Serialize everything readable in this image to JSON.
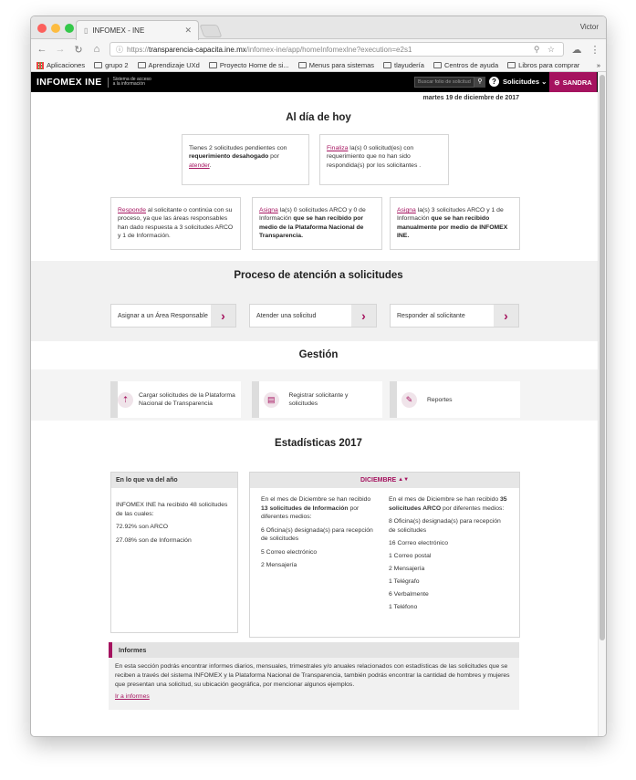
{
  "browser": {
    "tab_title": "INFOMEX - INE",
    "profile_name": "Victor",
    "url_protocol": "https://",
    "url_host": "transparencia-capacita.ine.mx",
    "url_path": "/infomex-ine/app/homeInfomexIne?execution=e2s1",
    "bookmarks": [
      "Aplicaciones",
      "grupo 2",
      "Aprendizaje UXd",
      "Proyecto Home de si...",
      "Menus para sistemas",
      "tlayudería",
      "Centros de ayuda",
      "Libros para comprar"
    ],
    "bookmarks_more": "»"
  },
  "header": {
    "logo": "INFOMEX INE",
    "logo_sub_1": "Sistema de acceso",
    "logo_sub_2": "a la información",
    "search_placeholder": "Buscar folio de solicitud",
    "help_label": "?",
    "solicitudes_label": "Solicitudes",
    "user_label": "SANDRA"
  },
  "date": "martes 19 de diciembre de 2017",
  "al_dia": {
    "title": "Al día de hoy",
    "card1": {
      "text_1": "Tienes 2 solicitudes pendientes con",
      "bold": "requerimiento desahogado",
      "text_2": " por",
      "link": "atender",
      "text_3": "."
    },
    "card2": {
      "link": "Finaliza",
      "text": " la(s) 0 solicitud(es) con requerimiento que no han sido respondida(s) por los solicitantes ."
    },
    "card3": {
      "link": "Responde",
      "text": " al solicitante o continúa con su proceso, ya que las áreas responsables han dado respuesta a 3 solicitudes ARCO y 1 de Información."
    },
    "card4": {
      "link": "Asigna",
      "text_1": " la(s) 0 solicitudes ARCO y 0 de Información ",
      "bold": "que se han recibido por medio de la Plataforma Nacional de Transparencia."
    },
    "card5": {
      "link": "Asigna",
      "text_1": " la(s) 3 solicitudes ARCO y 1 de Información ",
      "bold": "que se han recibido manualmente por medio de INFOMEX INE."
    }
  },
  "proceso": {
    "title": "Proceso de atención a solicitudes",
    "steps": [
      "Asignar a un Área Responsable",
      "Atender una solicitud",
      "Responder al solicitante"
    ]
  },
  "gestion": {
    "title": "Gestión",
    "items": [
      "Cargar solicitudes de la Plataforma Nacional de Transparencia",
      "Registrar solicitante y solicitudes",
      "Reportes"
    ]
  },
  "estadisticas": {
    "title": "Estadísticas 2017",
    "year_box": {
      "header": "En lo que va del año",
      "intro": "INFOMEX INE ha recibido 48 solicitudes de las cuales:",
      "arco": "72.92% son ARCO",
      "info": "27.08% son de Información"
    },
    "month_selector": "DICIEMBRE",
    "month_left": {
      "intro_1": "En el mes de Diciembre se han recibido ",
      "bold": "13 solicitudes de Información",
      "intro_2": " por diferentes medios:",
      "items": [
        "6 Oficina(s) designada(s) para recepción de solicitudes",
        "5 Correo electrónico",
        "2 Mensajería"
      ]
    },
    "month_right": {
      "intro_1": "En el mes de Diciembre se han recibido ",
      "bold": "35 solicitudes ARCO",
      "intro_2": " por diferentes medios:",
      "items": [
        "8 Oficina(s) designada(s) para recepción de solicitudes",
        "16 Correo electrónico",
        "1 Correo postal",
        "2 Mensajería",
        "1 Telégrafo",
        "6 Verbalmente",
        "1 Teléfono"
      ]
    }
  },
  "informes": {
    "title": "Informes",
    "text": "En esta sección podrás encontrar informes diarios, mensuales, trimestrales y/o anuales relacionados con estadísticas de las solicitudes que se reciben a través del sistema INFOMEX y la Plataforma Nacional de Transparencia, también podrás encontrar la cantidad de hombres y mujeres que presentan una solicitud, su ubicación geográfica, por mencionar algunos ejemplos.",
    "link": "Ir a informes"
  },
  "colors": {
    "accent": "#a5135f",
    "header_bg": "#000000",
    "section_bg": "#f1f1f1"
  }
}
